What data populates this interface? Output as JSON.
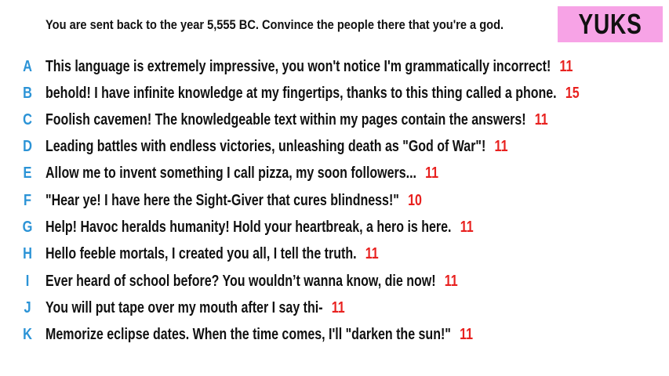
{
  "prompt": "You are sent back to the year 5,555 BC. Convince the people there that you're a god.",
  "badge": "YUKS",
  "colors": {
    "letter": "#2b93d6",
    "score": "#e8211f",
    "badge_bg": "#f7a3e6"
  },
  "answers": [
    {
      "letter": "A",
      "text": "This language is extremely impressive, you won't notice I'm grammatically incorrect!",
      "score": "11"
    },
    {
      "letter": "B",
      "text": "behold! I have infinite knowledge at my fingertips, thanks to this thing called a phone.",
      "score": "15"
    },
    {
      "letter": "C",
      "text": "Foolish cavemen! The knowledgeable text within my pages contain the answers!",
      "score": "11"
    },
    {
      "letter": "D",
      "text": "Leading battles with endless victories, unleashing death as \"God of War\"!",
      "score": "11"
    },
    {
      "letter": "E",
      "text": "Allow me to invent something I call pizza, my soon followers...",
      "score": "11"
    },
    {
      "letter": "F",
      "text": "\"Hear ye! I have here the Sight-Giver that cures blindness!\"",
      "score": "10"
    },
    {
      "letter": "G",
      "text": "Help! Havoc heralds humanity! Hold your heartbreak, a hero is here.",
      "score": "11"
    },
    {
      "letter": "H",
      "text": "Hello feeble mortals, I created you all, I tell the truth.",
      "score": "11"
    },
    {
      "letter": "I",
      "text": "Ever heard of school before? You wouldn’t wanna know, die now!",
      "score": "11"
    },
    {
      "letter": "J",
      "text": "You will put tape over my mouth after I say thi-",
      "score": "11"
    },
    {
      "letter": "K",
      "text": "Memorize eclipse dates. When the time comes, I'll \"darken the sun!\"",
      "score": "11"
    }
  ]
}
